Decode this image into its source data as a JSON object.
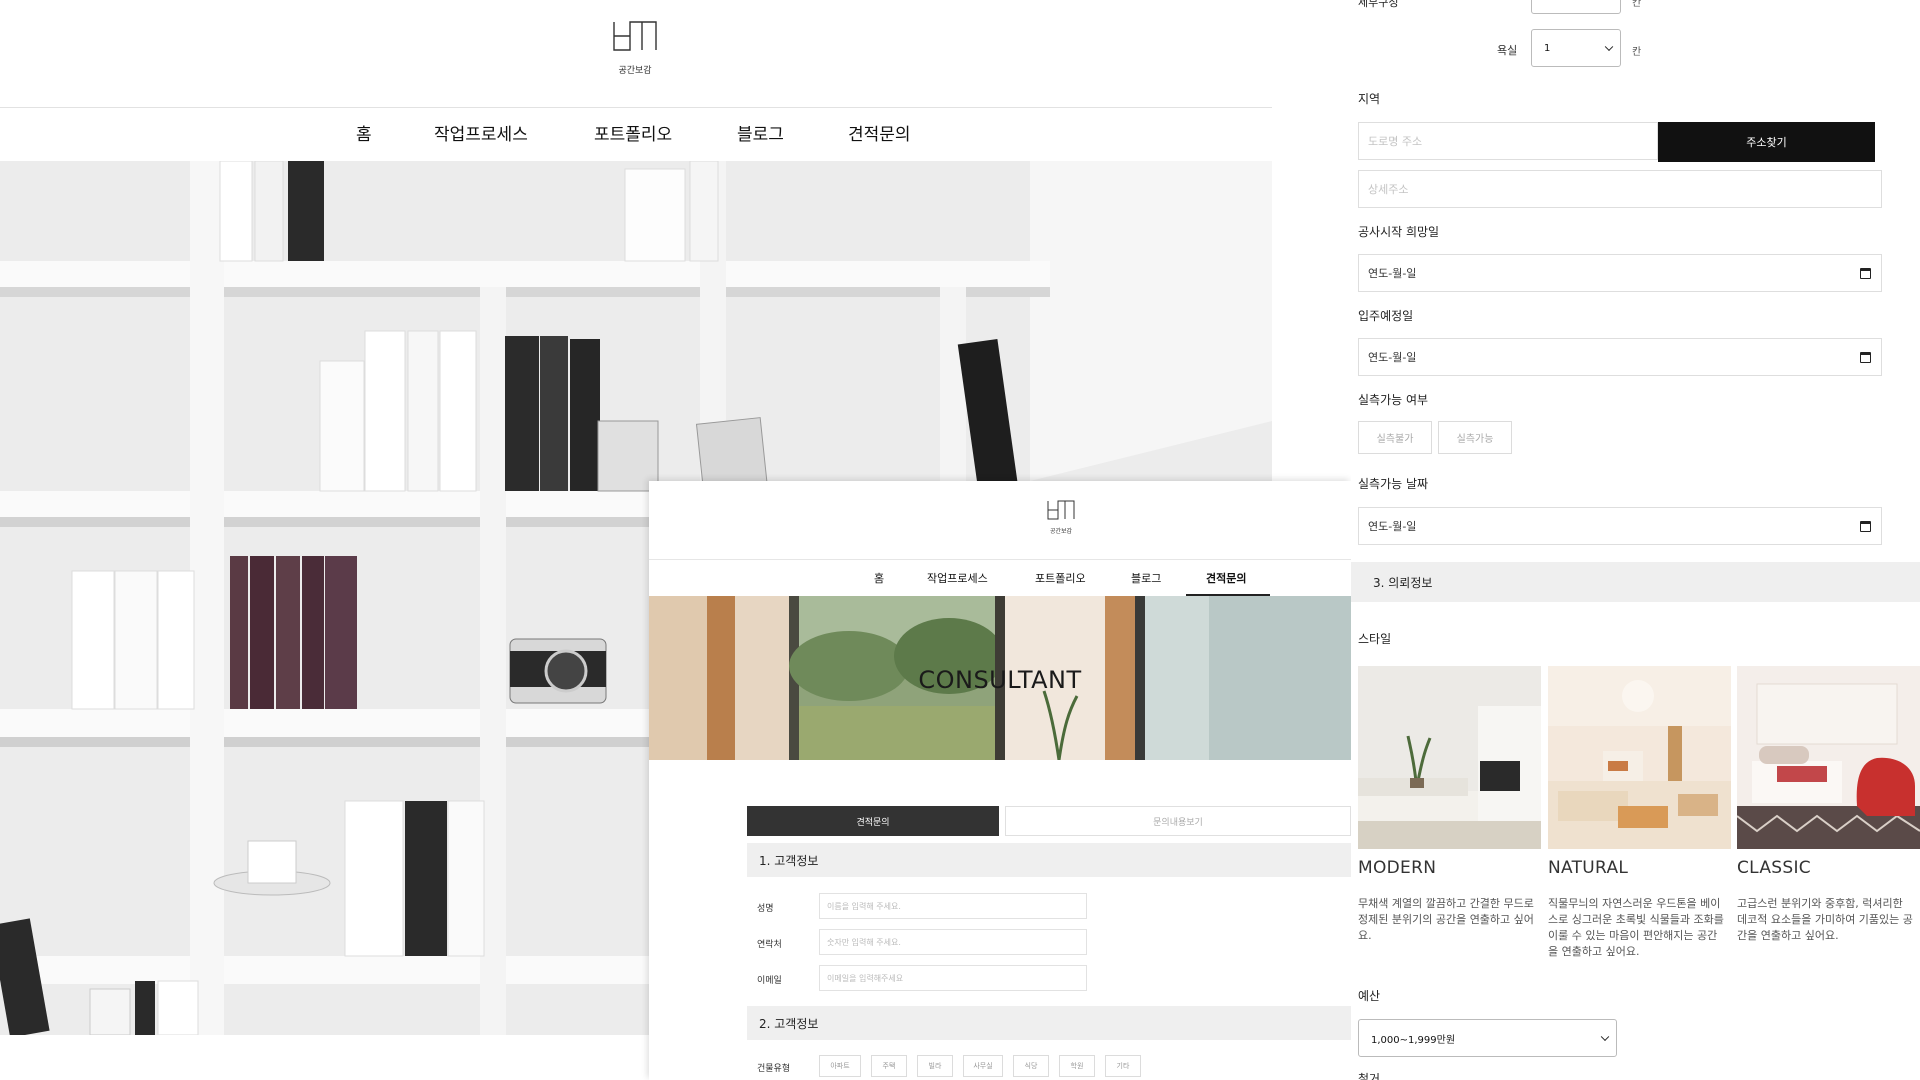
{
  "panel1": {
    "logo_text": "공간보감",
    "nav": [
      "홈",
      "작업프로세스",
      "포트폴리오",
      "블로그",
      "견적문의"
    ]
  },
  "panel2": {
    "logo_text": "공간보감",
    "nav": [
      "홈",
      "작업프로세스",
      "포트폴리오",
      "블로그",
      "견적문의"
    ],
    "banner_title": "CONSULTANT",
    "tabs": [
      "견적문의",
      "문의내용보기"
    ],
    "section1": "1. 고객정보",
    "fields": [
      {
        "label": "성명",
        "placeholder": "이름을 입력해 주세요."
      },
      {
        "label": "연락처",
        "placeholder": "숫자만 입력해 주세요."
      },
      {
        "label": "이메일",
        "placeholder": "이메일을 입력해주세요"
      }
    ],
    "section2": "2. 고객정보",
    "building_label": "건물유형",
    "building_types": [
      "아파트",
      "주택",
      "빌라",
      "사무실",
      "식당",
      "학원",
      "기타"
    ]
  },
  "panel3": {
    "top_row_label": "세부구성",
    "top_row_unit_a": "칸",
    "bath_label": "욕실",
    "bath_value": "1",
    "bath_unit": "칸",
    "region_label": "지역",
    "address_placeholder": "도로명 주소",
    "address_button": "주소찾기",
    "detail_placeholder": "상세주소",
    "start_label": "공사시작 희망일",
    "date_placeholder": "연도-월-일",
    "movein_label": "입주예정일",
    "measure_label": "실측가능 여부",
    "measure_options": [
      "실측불가",
      "실측가능"
    ],
    "measure_date_label": "실측가능 날짜",
    "section3": "3. 의뢰정보",
    "style_label": "스타일",
    "styles": [
      {
        "name": "MODERN",
        "desc": "무채색 계열의 깔끔하고 간결한 무드로 정제된 분위기의 공간을 연출하고 싶어요."
      },
      {
        "name": "NATURAL",
        "desc": "직물무늬의 자연스러운 우드톤을 베이스로 싱그러운 초록빛 식물들과 조화를 이룰 수 있는 마음이 편안해지는 공간을 연출하고 싶어요."
      },
      {
        "name": "CLASSIC",
        "desc": "고급스런 분위기와 중후함, 럭셔리한 데코적 요소들을 가미하여 기품있는 공간을 연출하고 싶어요."
      }
    ],
    "budget_label": "예산",
    "budget_value": "1,000~1,999만원",
    "demolition_label": "철거"
  }
}
